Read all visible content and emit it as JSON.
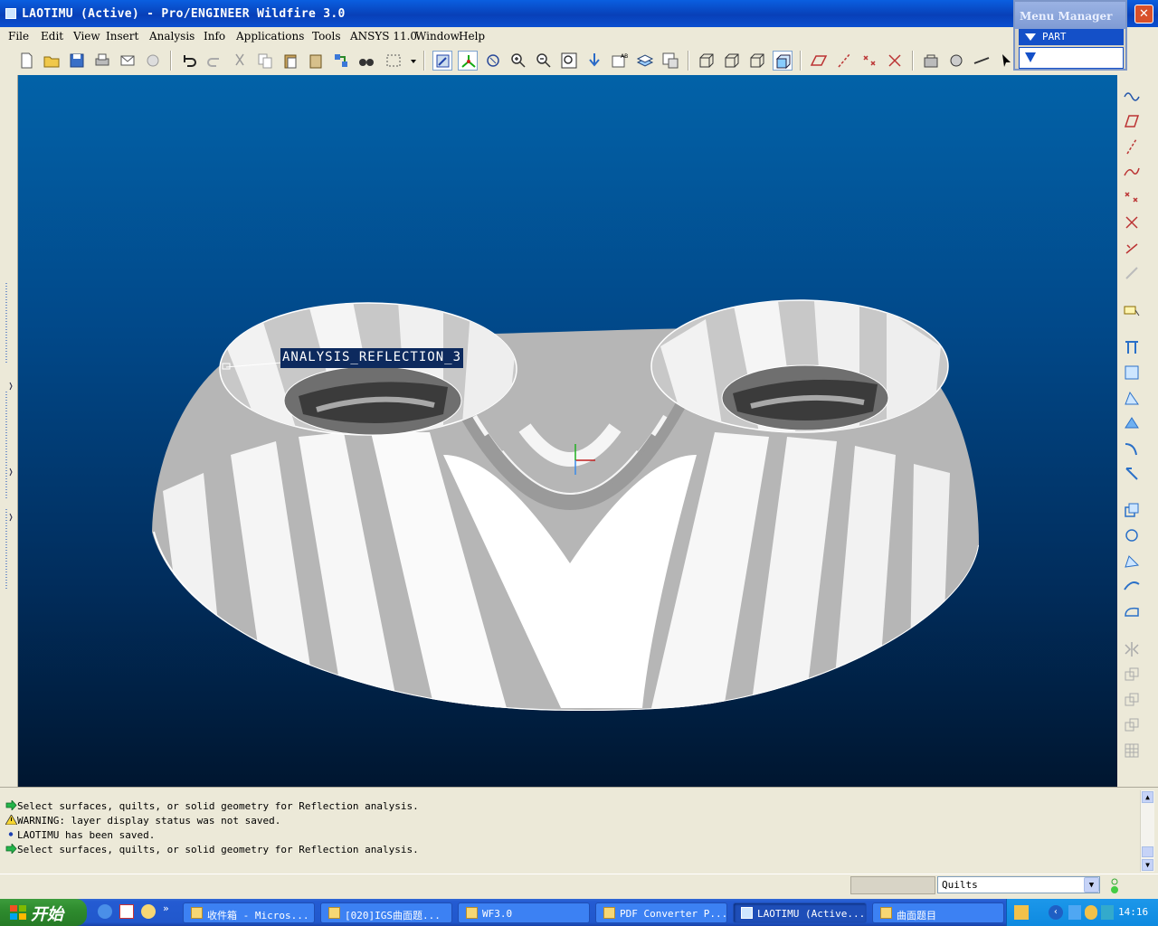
{
  "window": {
    "title": "LAOTIMU (Active) - Pro/ENGINEER Wildfire 3.0",
    "close_label": "✕"
  },
  "menu": {
    "items": [
      "File",
      "Edit",
      "View",
      "Insert",
      "Analysis",
      "Info",
      "Applications",
      "Tools",
      "ANSYS 11.0",
      "Window",
      "Help"
    ]
  },
  "menu_manager": {
    "title": "Menu Manager",
    "part_label": "PART"
  },
  "viewport": {
    "analysis_label": "ANALYSIS_REFLECTION_3",
    "background_top": "#0262a8",
    "background_bottom": "#001630"
  },
  "messages": [
    {
      "icon": "arrow-icon",
      "text": "Select surfaces, quilts, or solid geometry for Reflection analysis."
    },
    {
      "icon": "warning-icon",
      "text": "WARNING: layer display status was not saved."
    },
    {
      "icon": "bullet-icon",
      "text": "LAOTIMU has been saved."
    },
    {
      "icon": "arrow-icon",
      "text": "Select surfaces, quilts, or solid geometry for Reflection analysis."
    }
  ],
  "status": {
    "filter_value": "Quilts"
  },
  "taskbar": {
    "start_label": "开始",
    "tasks": [
      {
        "label": "收件箱 - Micros..."
      },
      {
        "label": "[020]IGS曲面题..."
      },
      {
        "label": "WF3.0"
      },
      {
        "label": "PDF Converter P..."
      },
      {
        "label": "LAOTIMU (Active..."
      },
      {
        "label": "曲面题目"
      }
    ],
    "clock": "14:16"
  }
}
